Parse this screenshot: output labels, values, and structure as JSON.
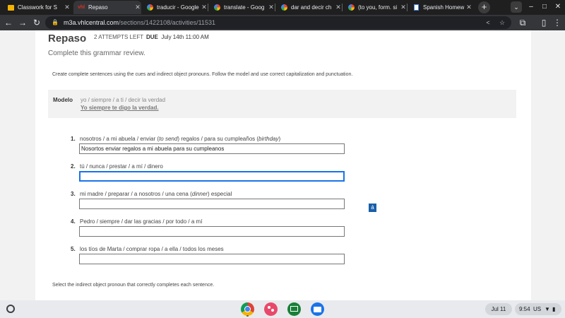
{
  "browser": {
    "tabs": [
      {
        "title": "Classwork for S",
        "icon": "classroom-icon"
      },
      {
        "title": "Repaso",
        "icon": "vhl-icon",
        "active": true
      },
      {
        "title": "traducir - Google",
        "icon": "google-icon"
      },
      {
        "title": "translate - Goog",
        "icon": "google-icon"
      },
      {
        "title": "dar and decir ch",
        "icon": "google-icon"
      },
      {
        "title": "(to you, form. si",
        "icon": "google-icon"
      },
      {
        "title": "Spanish Homew",
        "icon": "docs-icon"
      }
    ],
    "url_host": "m3a.vhlcentral.com",
    "url_path": "/sections/1422108/activities/11531"
  },
  "activity": {
    "title": "Repaso",
    "attempts_left": "2 ATTEMPTS LEFT",
    "due_label": "DUE",
    "due_date": "July 14th 11:00 AM",
    "subtitle": "Complete this grammar review.",
    "instructions": "Create complete sentences using the cues and indirect object pronouns. Follow the model and use correct capitalization and punctuation.",
    "model": {
      "label": "Modelo",
      "cue": "yo / siempre / a ti / decir la verdad",
      "answer": "Yo siempre te digo la verdad."
    },
    "items": [
      {
        "number": "1.",
        "parts": [
          {
            "text": "nosotros / a mi abuela / enviar ("
          },
          {
            "text": "to send",
            "italic": true
          },
          {
            "text": ") regalos / para su cumpleaños ("
          },
          {
            "text": "birthday",
            "italic": true
          },
          {
            "text": ")"
          }
        ],
        "value": "Nosortos enviar regalos a mi abuela para su cumpleanos"
      },
      {
        "number": "2.",
        "parts": [
          {
            "text": "tú / nunca / prestar / a mí / dinero"
          }
        ],
        "value": "",
        "focused": true
      },
      {
        "number": "3.",
        "parts": [
          {
            "text": "mi madre / preparar / a nosotros / una cena ("
          },
          {
            "text": "dinner",
            "italic": true
          },
          {
            "text": ") especial"
          }
        ],
        "value": ""
      },
      {
        "number": "4.",
        "parts": [
          {
            "text": "Pedro / siempre / dar las gracias / por todo / a mí"
          }
        ],
        "value": ""
      },
      {
        "number": "5.",
        "parts": [
          {
            "text": "los tíos de Marta / comprar ropa / a ella / todos los meses"
          }
        ],
        "value": ""
      }
    ],
    "accent_button": "á",
    "next_instructions": "Select the indirect object pronoun that correctly completes each sentence."
  },
  "shelf": {
    "date": "Jul 11",
    "time": "9:54",
    "locale": "US"
  },
  "colors": {
    "focus": "#1a73e8",
    "accent_button_bg": "#1a5fa8",
    "modelo_bg": "#f2f2f2"
  }
}
